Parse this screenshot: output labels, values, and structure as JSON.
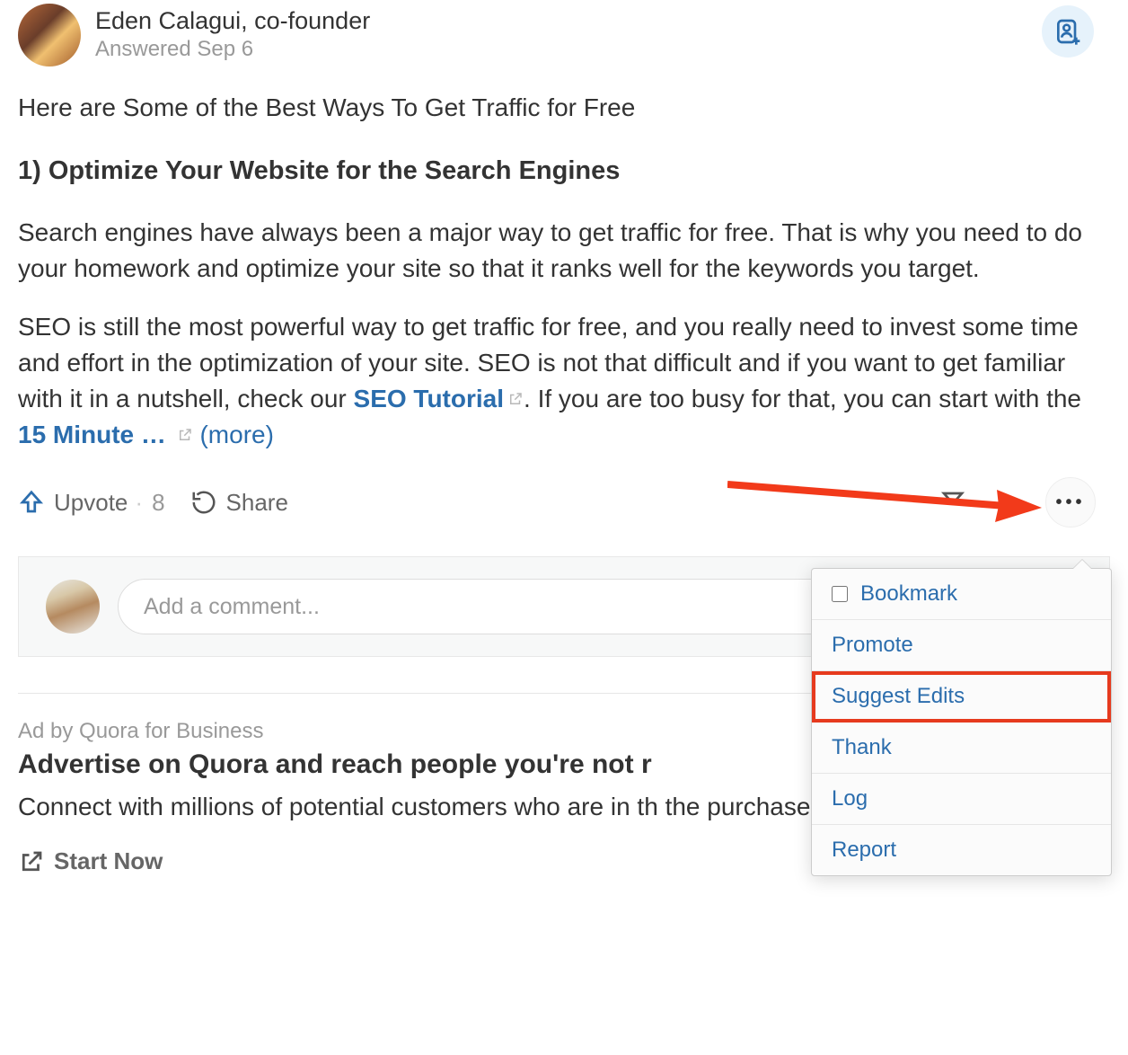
{
  "answer": {
    "author_name": "Eden Calagui, co-founder",
    "answered_line": "Answered Sep 6",
    "intro": "Here are Some of the Best Ways To Get Traffic for Free",
    "heading": "1) Optimize Your Website for the Search Engines",
    "para1": "Search engines have always been a major way to get traffic for free. That is why you need to do your homework and optimize your site so that it ranks well for the keywords you target.",
    "para2_a": "SEO is still the most powerful way to get traffic for free, and you really need to invest some time and effort in the optimization of your site. SEO is not that difficult and if you want to get familiar with it in a nutshell, check our ",
    "link1": "SEO Tutorial",
    "para2_b": ". If you are too busy for that, you can start with the ",
    "link2": "15 Minute …",
    "more_label": "(more)"
  },
  "actions": {
    "upvote_label": "Upvote",
    "upvote_count": "8",
    "share_label": "Share"
  },
  "comment": {
    "placeholder": "Add a comment..."
  },
  "ad": {
    "by_line": "Ad by Quora for Business",
    "title": "Advertise on Quora and reach people you're not r",
    "desc": "Connect with millions of potential customers who are in th the purchase funnel.",
    "cta": "Start Now"
  },
  "dropdown": {
    "items": [
      {
        "label": "Bookmark",
        "checkbox": true
      },
      {
        "label": "Promote"
      },
      {
        "label": "Suggest Edits",
        "highlighted": true
      },
      {
        "label": "Thank"
      },
      {
        "label": "Log"
      },
      {
        "label": "Report"
      }
    ]
  }
}
